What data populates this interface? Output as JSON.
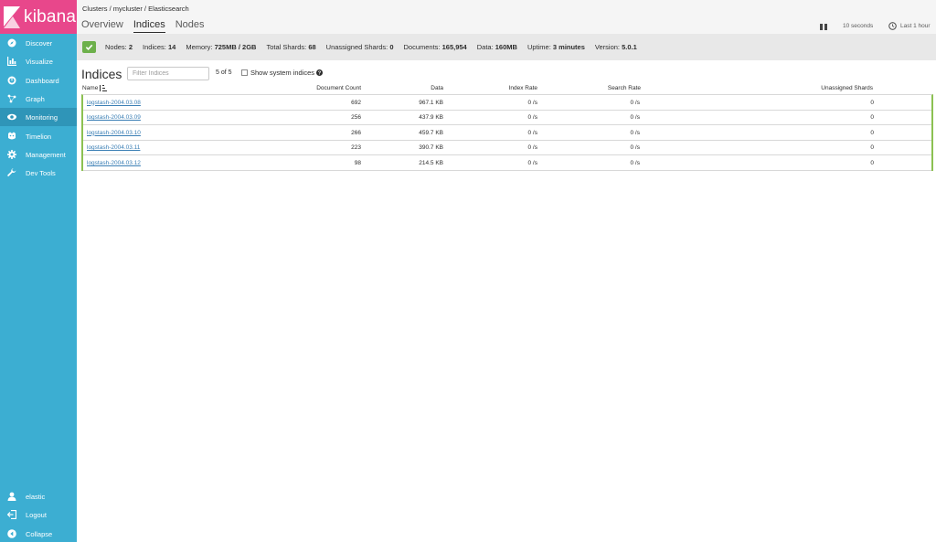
{
  "app": {
    "name": "kibana"
  },
  "sidebar": {
    "items": [
      {
        "label": "Discover",
        "icon": "compass-icon"
      },
      {
        "label": "Visualize",
        "icon": "bar-chart-icon"
      },
      {
        "label": "Dashboard",
        "icon": "dashboard-icon"
      },
      {
        "label": "Graph",
        "icon": "graph-icon"
      },
      {
        "label": "Monitoring",
        "icon": "eye-icon",
        "active": true
      },
      {
        "label": "Timelion",
        "icon": "timelion-icon"
      },
      {
        "label": "Management",
        "icon": "gear-icon"
      },
      {
        "label": "Dev Tools",
        "icon": "wrench-icon"
      }
    ],
    "footer": [
      {
        "label": "elastic",
        "icon": "user-icon"
      },
      {
        "label": "Logout",
        "icon": "logout-icon"
      },
      {
        "label": "Collapse",
        "icon": "collapse-icon"
      }
    ]
  },
  "header": {
    "breadcrumb": "Clusters / mycluster / Elasticsearch",
    "tabs": [
      {
        "label": "Overview",
        "active": false
      },
      {
        "label": "Indices",
        "active": true
      },
      {
        "label": "Nodes",
        "active": false
      }
    ],
    "refresh_interval": "10 seconds",
    "time_range": "Last 1 hour"
  },
  "summary": {
    "status": "green",
    "nodes_label": "Nodes:",
    "nodes_value": "2",
    "indices_label": "Indices:",
    "indices_value": "14",
    "memory_label": "Memory:",
    "memory_value": "725MB / 2GB",
    "shards_label": "Total Shards:",
    "shards_value": "68",
    "unassigned_label": "Unassigned Shards:",
    "unassigned_value": "0",
    "documents_label": "Documents:",
    "documents_value": "165,954",
    "data_label": "Data:",
    "data_value": "160MB",
    "uptime_label": "Uptime:",
    "uptime_value": "3 minutes",
    "version_label": "Version:",
    "version_value": "5.0.1"
  },
  "indices": {
    "title": "Indices",
    "filter_placeholder": "Filter Indices",
    "count_label": "5 of 5",
    "show_system_label": "Show system indices",
    "columns": {
      "name": "Name",
      "document_count": "Document Count",
      "data": "Data",
      "index_rate": "Index Rate",
      "search_rate": "Search Rate",
      "unassigned_shards": "Unassigned Shards"
    },
    "rows": [
      {
        "name": "logstash-2004.03.08",
        "document_count": "692",
        "data": "967.1 KB",
        "index_rate": "0 /s",
        "search_rate": "0 /s",
        "unassigned_shards": "0"
      },
      {
        "name": "logstash-2004.03.09",
        "document_count": "256",
        "data": "437.9 KB",
        "index_rate": "0 /s",
        "search_rate": "0 /s",
        "unassigned_shards": "0"
      },
      {
        "name": "logstash-2004.03.10",
        "document_count": "266",
        "data": "459.7 KB",
        "index_rate": "0 /s",
        "search_rate": "0 /s",
        "unassigned_shards": "0"
      },
      {
        "name": "logstash-2004.03.11",
        "document_count": "223",
        "data": "390.7 KB",
        "index_rate": "0 /s",
        "search_rate": "0 /s",
        "unassigned_shards": "0"
      },
      {
        "name": "logstash-2004.03.12",
        "document_count": "98",
        "data": "214.5 KB",
        "index_rate": "0 /s",
        "search_rate": "0 /s",
        "unassigned_shards": "0"
      }
    ]
  },
  "colors": {
    "sidebar_bg": "#3caed2",
    "logo_bg": "#e8478b",
    "status_green": "#6db04b",
    "row_border_green": "#8cc152",
    "link": "#3b7fb5"
  }
}
